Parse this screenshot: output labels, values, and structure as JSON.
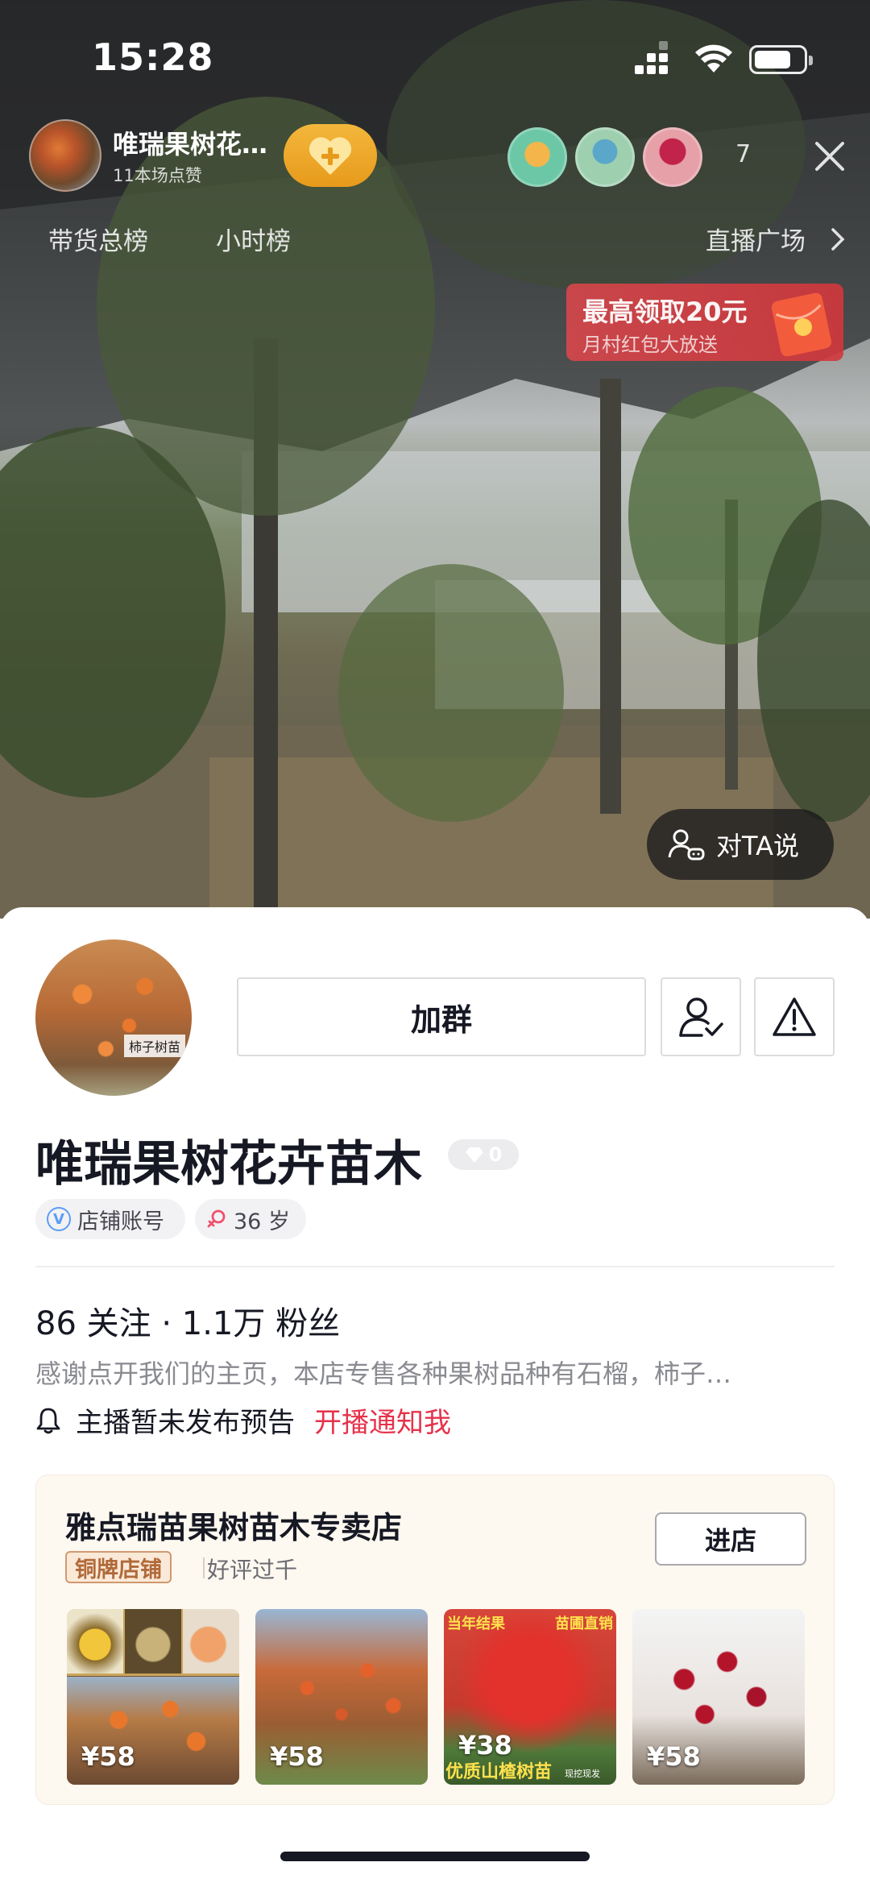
{
  "status_bar": {
    "time": "15:28"
  },
  "live": {
    "host_name": "唯瑞果树花…",
    "host_likes": "11本场点赞",
    "viewer_count": "7",
    "rank_tabs": [
      "带货总榜",
      "小时榜"
    ],
    "plaza_label": "直播广场",
    "red_packet": {
      "title": "最高领取20元",
      "subtitle": "月村红包大放送"
    },
    "say_button": "对TA说"
  },
  "profile": {
    "join_group": "加群",
    "name": "唯瑞果树花卉苗木",
    "diamond_count": "0",
    "tags": {
      "store": "店铺账号",
      "age": "36 岁"
    },
    "stats": "86 关注 · 1.1万 粉丝",
    "bio": "感谢点开我们的主页，本店专售各种果树品种有石榴，柿子…",
    "notice": "主播暂未发布预告",
    "notify_link": "开播通知我",
    "avatar_caption": "柿子树苗"
  },
  "store": {
    "name": "雅点瑞苗果树苗木专卖店",
    "badge": "铜牌店铺",
    "rating": "好评过千",
    "enter_button": "进店",
    "products": [
      {
        "price": "¥58"
      },
      {
        "price": "¥58"
      },
      {
        "price": "¥38",
        "tag_left": "当年结果",
        "tag_right": "苗圃直销",
        "bottom_text": "优质山楂树苗",
        "small_text": "现挖现发"
      },
      {
        "price": "¥58"
      }
    ]
  },
  "colors": {
    "accent_red": "#e6324b",
    "heart_button": "#f0ad32",
    "bronze": "#b06a3a"
  }
}
